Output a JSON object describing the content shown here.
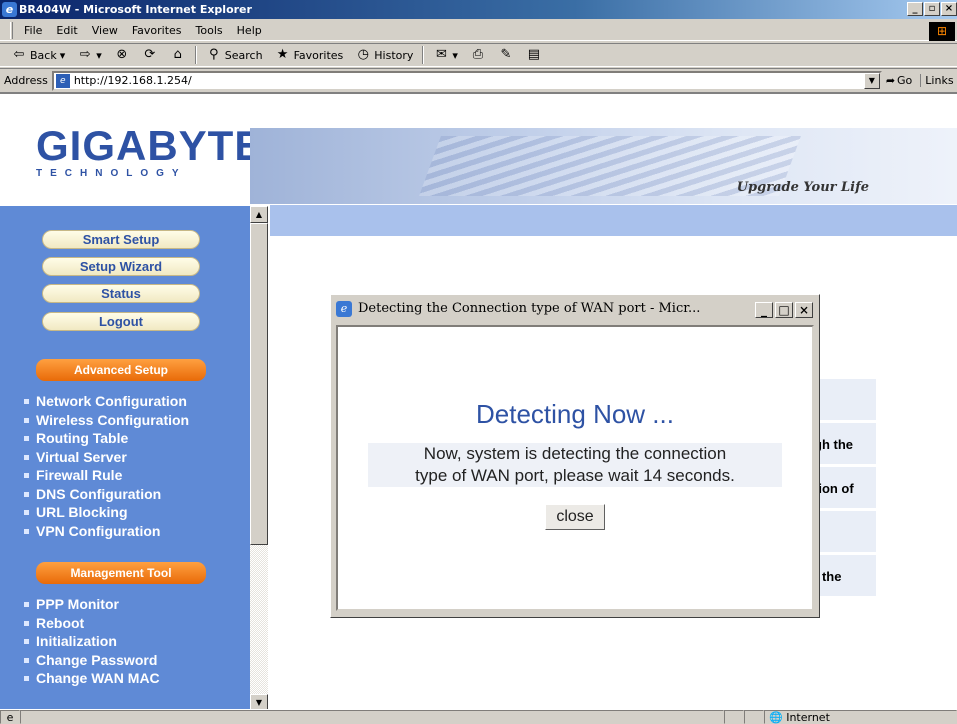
{
  "window": {
    "title": "BR404W - Microsoft Internet Explorer"
  },
  "menu": [
    "File",
    "Edit",
    "View",
    "Favorites",
    "Tools",
    "Help"
  ],
  "toolbar": {
    "back": "Back",
    "search": "Search",
    "favorites": "Favorites",
    "history": "History"
  },
  "address": {
    "label": "Address",
    "url": "http://192.168.1.254/",
    "go": "Go",
    "links": "Links"
  },
  "brand": {
    "name": "GIGABYTE",
    "sub": "TECHNOLOGY",
    "slogan": "Upgrade Your Life"
  },
  "sidebar": {
    "buttons": [
      "Smart Setup",
      "Setup Wizard",
      "Status",
      "Logout"
    ],
    "advanced_title": "Advanced Setup",
    "advanced_items": [
      "Network Configuration",
      "Wireless Configuration",
      "Routing Table",
      "Virtual Server",
      "Firewall Rule",
      "DNS Configuration",
      "URL Blocking",
      "VPN Configuration"
    ],
    "management_title": "Management Tool",
    "management_items": [
      "PPP Monitor",
      "Reboot",
      "Initialization",
      "Change Password",
      "Change WAN MAC"
    ]
  },
  "background_rows": [
    "",
    "gh the",
    "tion of",
    "",
    "f the"
  ],
  "popup": {
    "title": "Detecting the Connection type of WAN port - Micr...",
    "heading": "Detecting Now ...",
    "line1": "Now, system is detecting the connection",
    "line2": "type of WAN port, please wait 14 seconds.",
    "close": "close"
  },
  "status": {
    "zone": "Internet"
  }
}
